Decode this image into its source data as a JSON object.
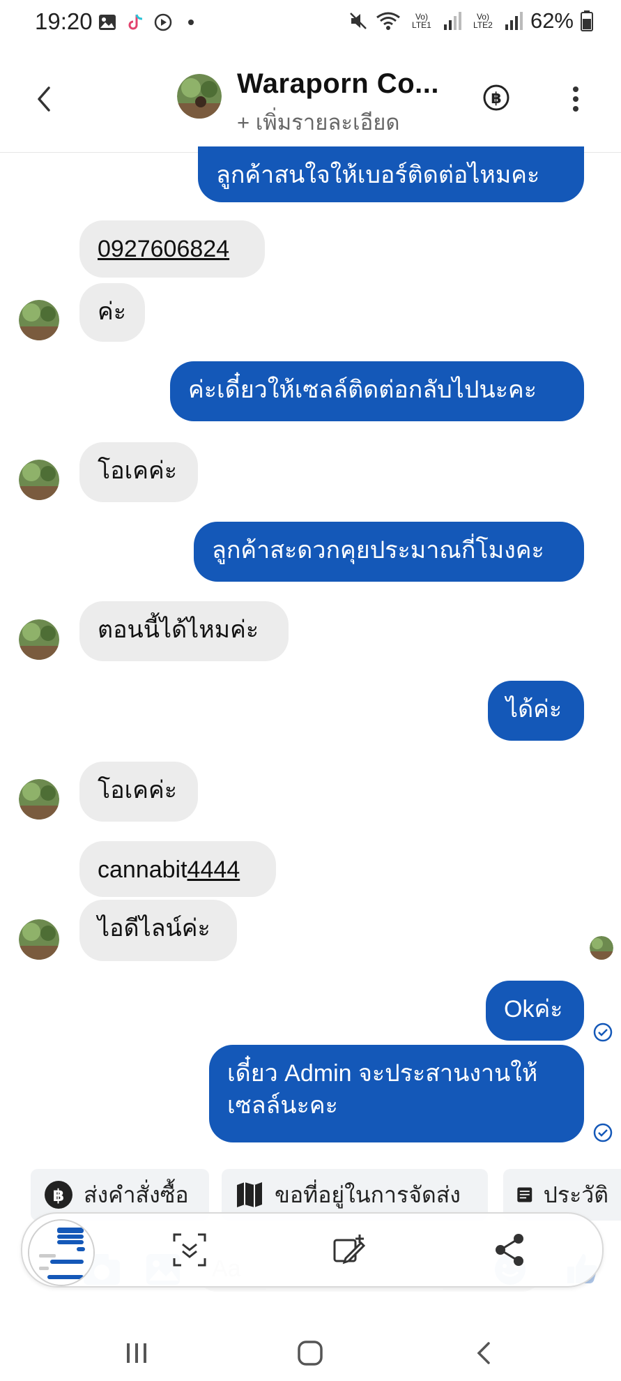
{
  "status_bar": {
    "time": "19:20",
    "battery": "62%",
    "net1": "Vo) LTE1",
    "net2": "Vo) LTE2"
  },
  "header": {
    "title": "Waraporn Co...",
    "subtitle": "+ เพิ่มรายละเอียด"
  },
  "messages": [
    {
      "dir": "out",
      "text": "ลูกค้าสนใจให้เบอร์ติดต่อไหมคะ"
    },
    {
      "dir": "in",
      "text": "0927606824"
    },
    {
      "dir": "in",
      "text": "ค่ะ"
    },
    {
      "dir": "out",
      "text": "ค่ะเดี๋ยวให้เซลล์ติดต่อกลับไปนะคะ"
    },
    {
      "dir": "in",
      "text": "โอเคค่ะ"
    },
    {
      "dir": "out",
      "text": "ลูกค้าสะดวกคุยประมาณกี่โมงคะ"
    },
    {
      "dir": "in",
      "text": "ตอนนี้ได้ไหมค่ะ"
    },
    {
      "dir": "out",
      "text": "ได้ค่ะ"
    },
    {
      "dir": "in",
      "text": "โอเคค่ะ"
    },
    {
      "dir": "in",
      "text_prefix": "cannabit",
      "text_link": "4444"
    },
    {
      "dir": "in",
      "text": "ไอดีไลน์ค่ะ"
    },
    {
      "dir": "out",
      "text": "Okค่ะ"
    },
    {
      "dir": "out",
      "line1": "เดี๋ยว Admin จะประสานงานให้",
      "line2": "เซลล์นะคะ"
    }
  ],
  "quick_actions": [
    {
      "label": "ส่งคำสั่งซื้อ",
      "icon": "baht-icon"
    },
    {
      "label": "ขอที่อยู่ในการจัดส่ง",
      "icon": "map-icon"
    },
    {
      "label": "ประวัติ",
      "icon": "list-icon"
    }
  ],
  "composer": {
    "placeholder": "Aa"
  }
}
